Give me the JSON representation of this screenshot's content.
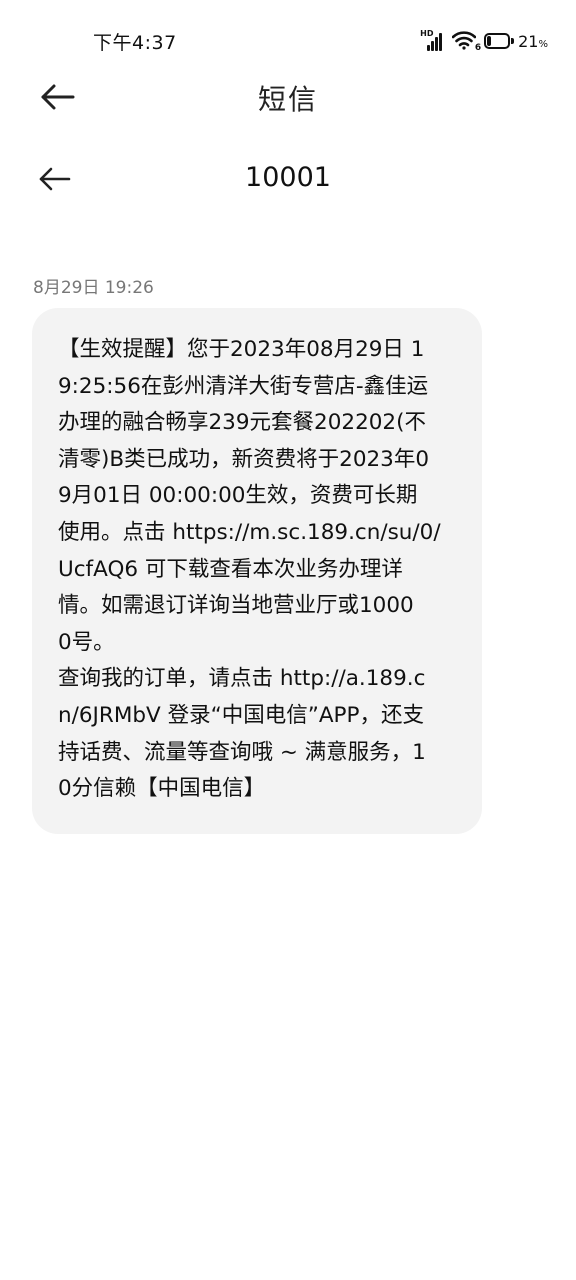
{
  "status_bar": {
    "time": "下午4:37",
    "hd_label": "HD",
    "wifi_suffix": "6",
    "battery_percent_value": 21,
    "battery_number": "21",
    "battery_symbol": "%"
  },
  "app_header": {
    "title": "短信",
    "back_icon": "arrow-left-icon"
  },
  "conversation": {
    "title": "10001",
    "back_icon": "arrow-left-icon"
  },
  "message": {
    "timestamp": "8月29日 19:26",
    "lines": [
      "【生效提醒】您于2023年08月29日 1",
      "9:25:56在彭州清洋大街专营店-鑫佳运",
      "办理的融合畅享239元套餐202202(不",
      "清零)B类已成功，新资费将于2023年0",
      "9月01日 00:00:00生效，资费可长期",
      "使用。点击 https://m.sc.189.cn/su/0/",
      "UcfAQ6 可下载查看本次业务办理详",
      "情。如需退订详询当地营业厅或1000",
      "0号。",
      "查询我的订单，请点击 http://a.189.c",
      "n/6JRMbV 登录“中国电信”APP，还支",
      "持话费、流量等查询哦 ~ 满意服务，1",
      "0分信赖【中国电信】"
    ]
  },
  "colors": {
    "bubble_bg": "#f3f3f3",
    "text_primary": "#111111",
    "text_secondary": "#777777"
  }
}
